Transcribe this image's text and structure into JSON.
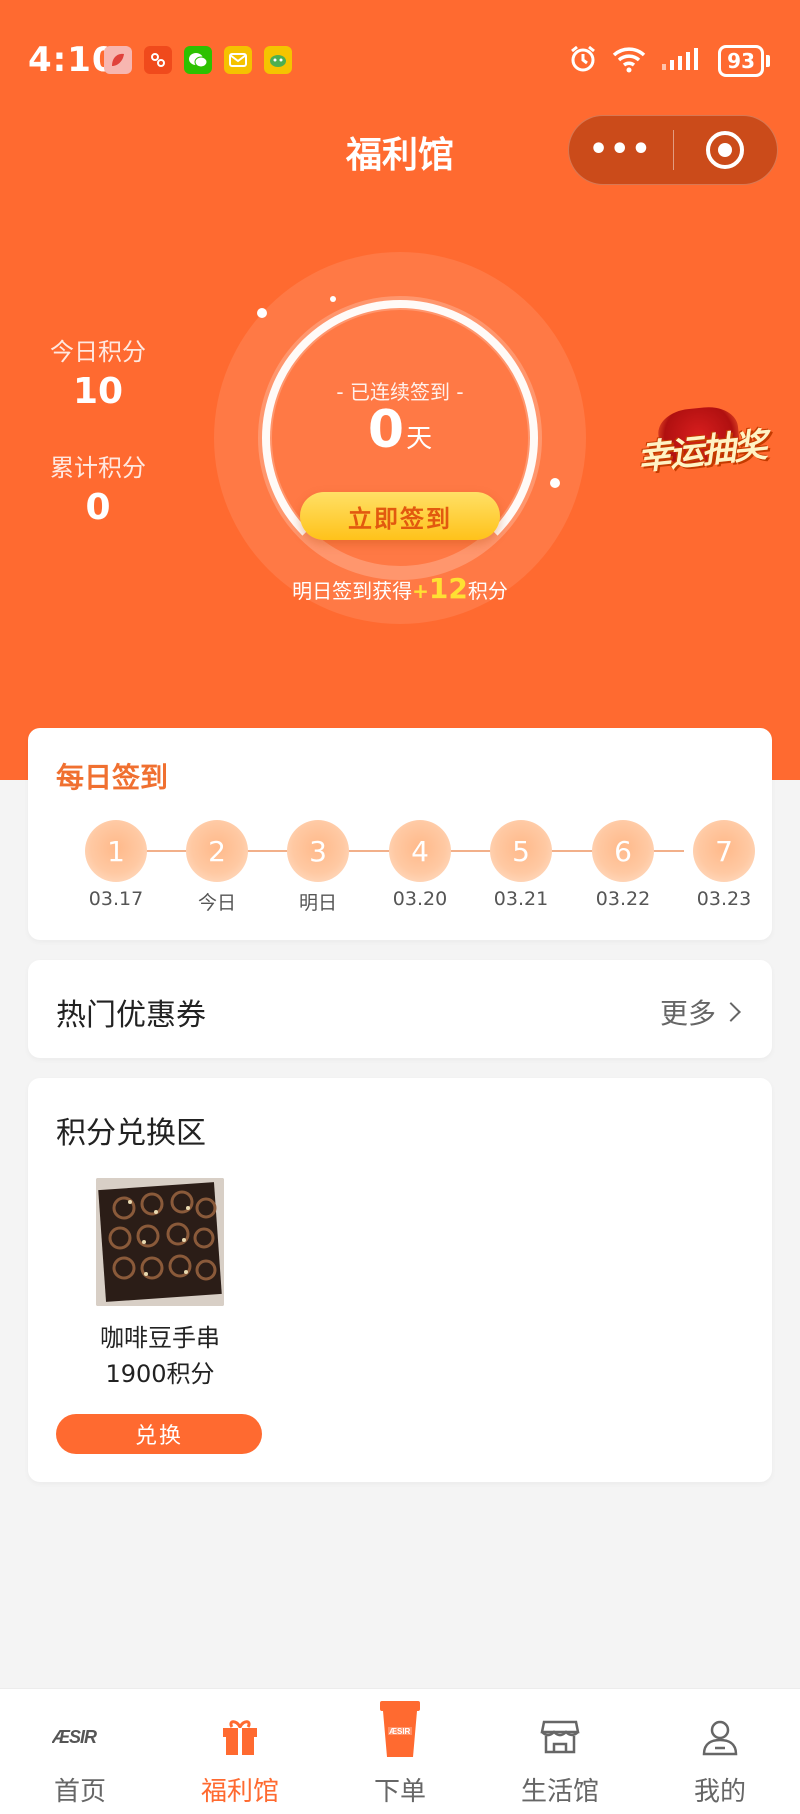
{
  "status_bar": {
    "time": "4:10",
    "battery": "93"
  },
  "header": {
    "title": "福利馆"
  },
  "points": {
    "today_label": "今日积分",
    "today_value": "10",
    "total_label": "累计积分",
    "total_value": "0"
  },
  "checkin": {
    "streak_label": "- 已连续签到 -",
    "streak_days": "0",
    "streak_unit": "天",
    "button_label": "立即签到",
    "tomorrow_prefix": "明日签到获得",
    "tomorrow_plus": "+",
    "tomorrow_points": "12",
    "tomorrow_suffix": "积分"
  },
  "lottery": {
    "text": "幸运抽奖"
  },
  "daily_checkin": {
    "title": "每日签到",
    "days": [
      {
        "num": "1",
        "date": "03.17"
      },
      {
        "num": "2",
        "date": "今日"
      },
      {
        "num": "3",
        "date": "明日"
      },
      {
        "num": "4",
        "date": "03.20"
      },
      {
        "num": "5",
        "date": "03.21"
      },
      {
        "num": "6",
        "date": "03.22"
      },
      {
        "num": "7",
        "date": "03.23"
      }
    ]
  },
  "coupons": {
    "title": "热门优惠券",
    "more_label": "更多"
  },
  "exchange": {
    "title": "积分兑换区",
    "product": {
      "name": "咖啡豆手串",
      "points": "1900积分",
      "button_label": "兑换"
    }
  },
  "bottom_nav": {
    "items": [
      {
        "label": "首页",
        "icon": "brand-logo-icon"
      },
      {
        "label": "福利馆",
        "icon": "gift-icon"
      },
      {
        "label": "下单",
        "icon": "coffee-cup-icon"
      },
      {
        "label": "生活馆",
        "icon": "store-icon"
      },
      {
        "label": "我的",
        "icon": "user-icon"
      }
    ],
    "active_index": 1
  },
  "colors": {
    "primary": "#ff6a30",
    "accent_yellow": "#ffe033"
  }
}
